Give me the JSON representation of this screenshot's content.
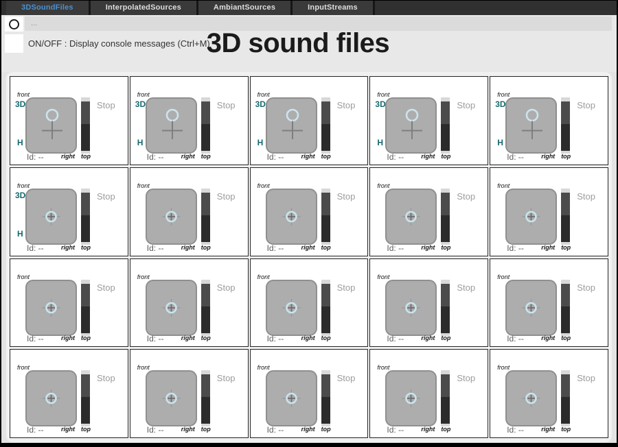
{
  "tabs": [
    {
      "label": "3DSoundFiles",
      "active": true
    },
    {
      "label": "InterpolatedSources",
      "active": false
    },
    {
      "label": "AmbiantSources",
      "active": false
    },
    {
      "label": "InputStreams",
      "active": false
    }
  ],
  "toolbar": {
    "path_value": "...",
    "console_toggle_label": "ON/OFF : Display console messages (Ctrl+M)",
    "console_checkbox_checked": false
  },
  "header": {
    "title": "3D sound files"
  },
  "panel": {
    "front_label": "front",
    "right_label": "right",
    "top_label": "top",
    "stop_label": "Stop",
    "id_label": "Id: --",
    "mode_3d_label": "3D",
    "mode_h_label": "H"
  },
  "colors": {
    "active_tab_text": "#4a90d2",
    "mode_label_teal": "#17696d",
    "marker_blue": "#cde3ec",
    "meter_upper": "#4b4b4b",
    "meter_lower": "#2b2b2b",
    "pad_gray": "#adadad"
  },
  "cards": [
    {
      "row": 1,
      "col": 1,
      "id_text": "Id: --",
      "show_mode_labels": true,
      "marker": "elevated"
    },
    {
      "row": 1,
      "col": 2,
      "id_text": "Id: --",
      "show_mode_labels": true,
      "marker": "elevated"
    },
    {
      "row": 1,
      "col": 3,
      "id_text": "Id: --",
      "show_mode_labels": true,
      "marker": "elevated"
    },
    {
      "row": 1,
      "col": 4,
      "id_text": "Id: --",
      "show_mode_labels": true,
      "marker": "elevated"
    },
    {
      "row": 1,
      "col": 5,
      "id_text": "Id: --",
      "show_mode_labels": true,
      "marker": "elevated"
    },
    {
      "row": 2,
      "col": 1,
      "id_text": "Id: --",
      "show_mode_labels": true,
      "marker": "center"
    },
    {
      "row": 2,
      "col": 2,
      "id_text": "Id: --",
      "show_mode_labels": false,
      "marker": "center"
    },
    {
      "row": 2,
      "col": 3,
      "id_text": "Id: --",
      "show_mode_labels": false,
      "marker": "center"
    },
    {
      "row": 2,
      "col": 4,
      "id_text": "Id: --",
      "show_mode_labels": false,
      "marker": "center"
    },
    {
      "row": 2,
      "col": 5,
      "id_text": "Id: --",
      "show_mode_labels": false,
      "marker": "center"
    },
    {
      "row": 3,
      "col": 1,
      "id_text": "Id: --",
      "show_mode_labels": false,
      "marker": "center"
    },
    {
      "row": 3,
      "col": 2,
      "id_text": "Id: --",
      "show_mode_labels": false,
      "marker": "center"
    },
    {
      "row": 3,
      "col": 3,
      "id_text": "Id: --",
      "show_mode_labels": false,
      "marker": "center"
    },
    {
      "row": 3,
      "col": 4,
      "id_text": "Id: --",
      "show_mode_labels": false,
      "marker": "center"
    },
    {
      "row": 3,
      "col": 5,
      "id_text": "Id: --",
      "show_mode_labels": false,
      "marker": "center"
    },
    {
      "row": 4,
      "col": 1,
      "id_text": "Id: --",
      "show_mode_labels": false,
      "marker": "center"
    },
    {
      "row": 4,
      "col": 2,
      "id_text": "Id: --",
      "show_mode_labels": false,
      "marker": "center"
    },
    {
      "row": 4,
      "col": 3,
      "id_text": "Id: --",
      "show_mode_labels": false,
      "marker": "center"
    },
    {
      "row": 4,
      "col": 4,
      "id_text": "Id: --",
      "show_mode_labels": false,
      "marker": "center"
    },
    {
      "row": 4,
      "col": 5,
      "id_text": "Id: --",
      "show_mode_labels": false,
      "marker": "center"
    }
  ]
}
